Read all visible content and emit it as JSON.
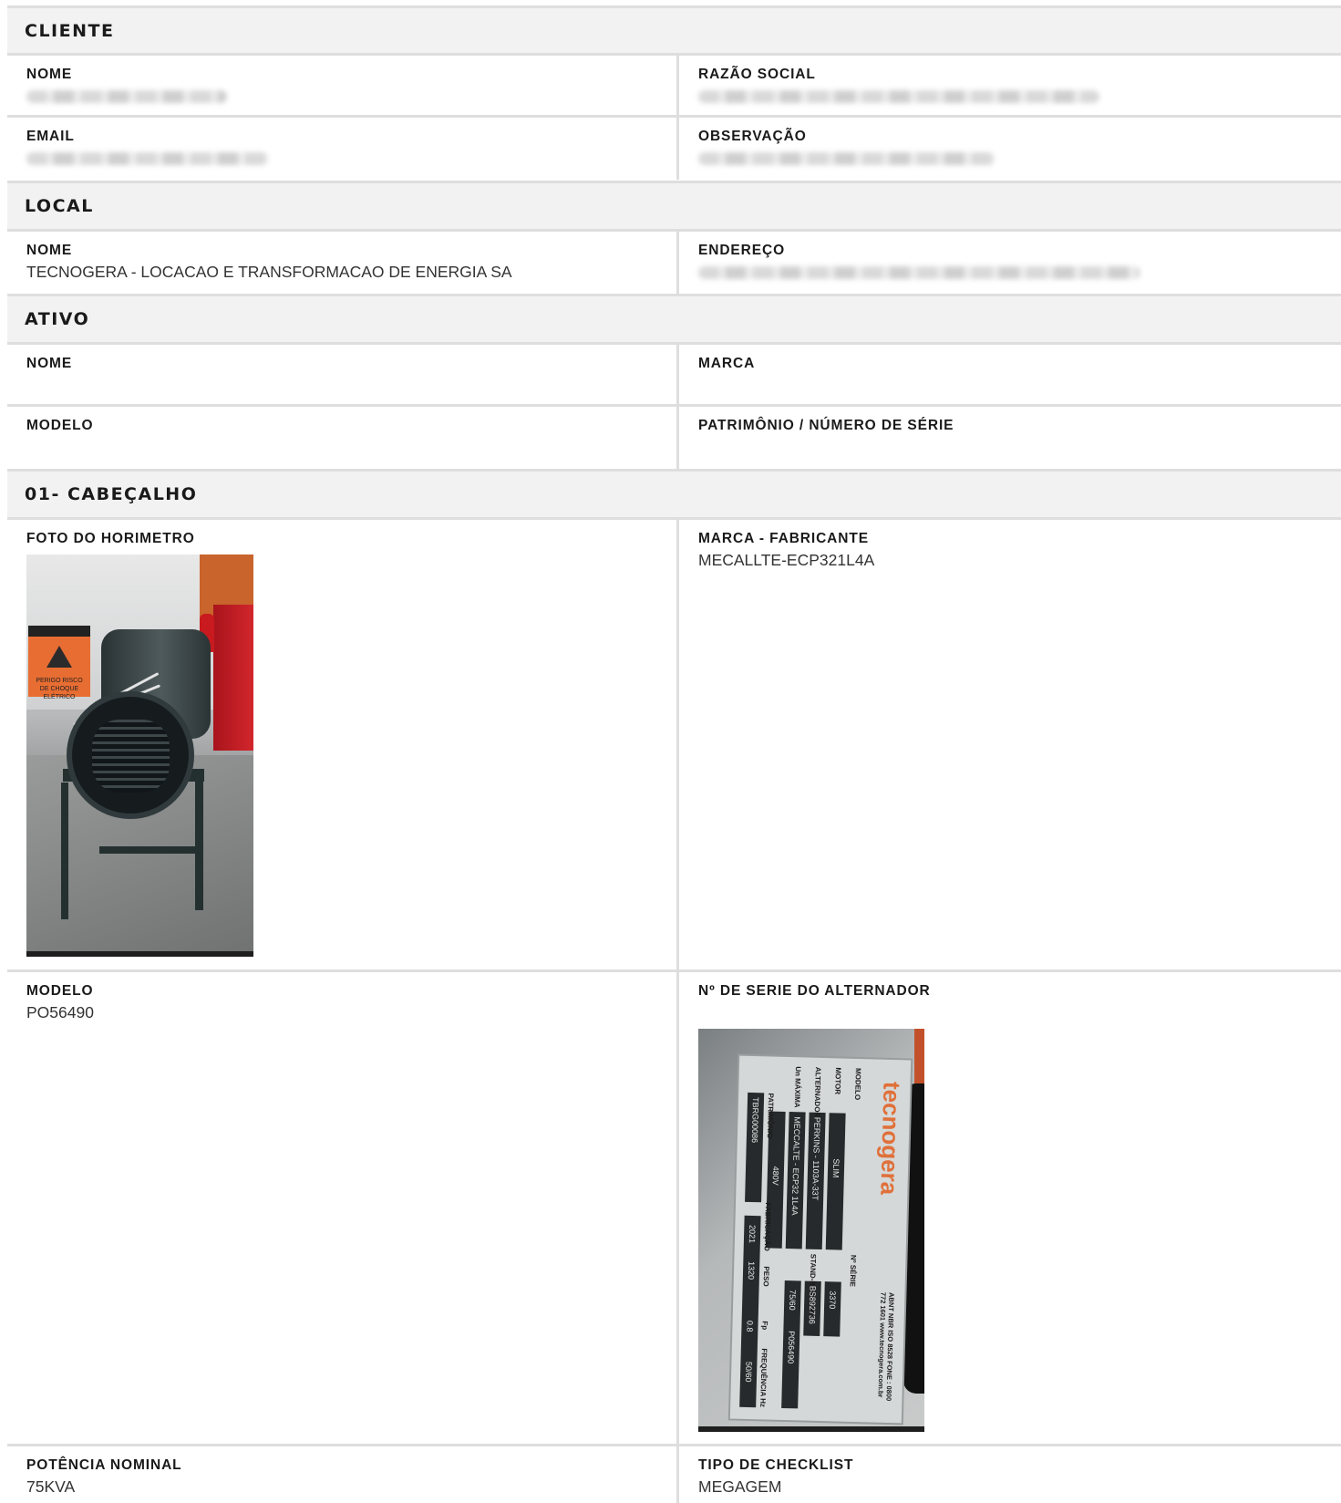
{
  "sections": {
    "cliente": "CLIENTE",
    "local": "LOCAL",
    "ativo": "ATIVO",
    "cabecalho": "01- CABEÇALHO"
  },
  "cliente": {
    "nome_label": "NOME",
    "razao_label": "RAZÃO SOCIAL",
    "email_label": "EMAIL",
    "observacao_label": "OBSERVAÇÃO"
  },
  "local": {
    "nome_label": "NOME",
    "nome_value": "TECNOGERA - LOCACAO E TRANSFORMACAO DE ENERGIA SA",
    "endereco_label": "ENDEREÇO"
  },
  "ativo": {
    "nome_label": "NOME",
    "marca_label": "MARCA",
    "modelo_label": "MODELO",
    "patrimonio_label": "PATRIMÔNIO / NÚMERO DE SÉRIE"
  },
  "cabecalho": {
    "foto_label": "FOTO DO HORIMETRO",
    "marca_fab_label": "MARCA - FABRICANTE",
    "marca_fab_value": "MECALLTE-ECP321L4A",
    "modelo_label": "MODELO",
    "modelo_value": "PO56490",
    "serie_label": "Nº DE SERIE DO ALTERNADOR",
    "potencia_label": "POTÊNCIA NOMINAL",
    "potencia_value": "75KVA",
    "tipo_label": "TIPO DE CHECKLIST",
    "tipo_value": "MEGAGEM"
  },
  "photo1": {
    "sign_text": "PERIGO RISCO DE CHOQUE ELÉTRICO"
  },
  "photo2": {
    "brand": "tecnogera",
    "fields": [
      "MODELO",
      "MOTOR",
      "ALTERNADOR",
      "Un MÁXIMA",
      "PATRIMÔNIO",
      "FABRICAÇÃO",
      "Nº SÉRIE",
      "STAND-BY kVA/kW",
      "PESO",
      "Fp",
      "FREQUÊNCIA Hz"
    ],
    "values": [
      "SLIM",
      "PERKINS - 1103A-33T",
      "MECCALTE - ECP32 1L4A",
      "480V",
      "TBRG00086",
      "2021",
      "3370",
      "BS892736",
      "P056490",
      "75/60",
      "1320",
      "0.8",
      "50/60"
    ],
    "contact": "ABNT NBR ISO 8528 FONE : 0800 772 1601 www.tecnogera.com.br"
  }
}
